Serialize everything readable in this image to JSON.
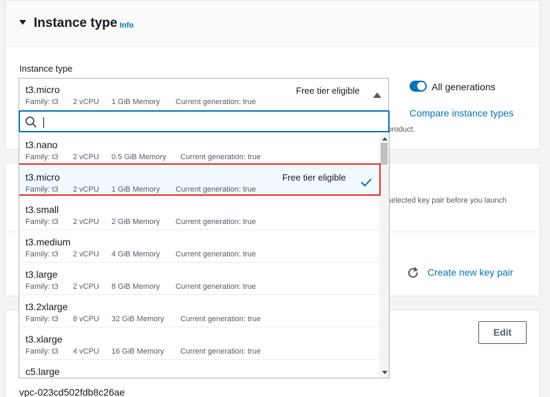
{
  "section": {
    "title": "Instance type",
    "info": "Info",
    "field_label": "Instance type"
  },
  "generations_toggle": {
    "label": "All generations",
    "on": true
  },
  "compare_link": "Compare instance types",
  "partial_texts": {
    "product": "product.",
    "key_pair_note": "selected key pair before you launch"
  },
  "key_pair": {
    "create_link": "Create new key pair",
    "refresh_icon": "refresh-icon"
  },
  "network": {
    "edit_label": "Edit",
    "vpc": "vpc-023cd502fdb8c26ae"
  },
  "selected": {
    "name": "t3.micro",
    "family": "Family: t3",
    "vcpu": "2 vCPU",
    "memory": "1 GiB Memory",
    "generation": "Current generation: true",
    "badge": "Free tier eligible"
  },
  "search": {
    "value": "",
    "placeholder": ""
  },
  "options": [
    {
      "name": "t3.nano",
      "family": "Family: t3",
      "vcpu": "2 vCPU",
      "memory": "0.5 GiB Memory",
      "generation": "Current generation: true"
    },
    {
      "name": "t3.micro",
      "family": "Family: t3",
      "vcpu": "2 vCPU",
      "memory": "1 GiB Memory",
      "generation": "Current generation: true",
      "badge": "Free tier eligible"
    },
    {
      "name": "t3.small",
      "family": "Family: t3",
      "vcpu": "2 vCPU",
      "memory": "2 GiB Memory",
      "generation": "Current generation: true"
    },
    {
      "name": "t3.medium",
      "family": "Family: t3",
      "vcpu": "2 vCPU",
      "memory": "4 GiB Memory",
      "generation": "Current generation: true"
    },
    {
      "name": "t3.large",
      "family": "Family: t3",
      "vcpu": "2 vCPU",
      "memory": "8 GiB Memory",
      "generation": "Current generation: true"
    },
    {
      "name": "t3.2xlarge",
      "family": "Family: t3",
      "vcpu": "8 vCPU",
      "memory": "32 GiB Memory",
      "generation": "Current generation: true"
    },
    {
      "name": "t3.xlarge",
      "family": "Family: t3",
      "vcpu": "4 vCPU",
      "memory": "16 GiB Memory",
      "generation": "Current generation: true"
    },
    {
      "name": "c5.large"
    }
  ],
  "colors": {
    "accent": "#0073bb",
    "highlight_border": "#e52b2b",
    "selected_bg": "#f1faff"
  }
}
